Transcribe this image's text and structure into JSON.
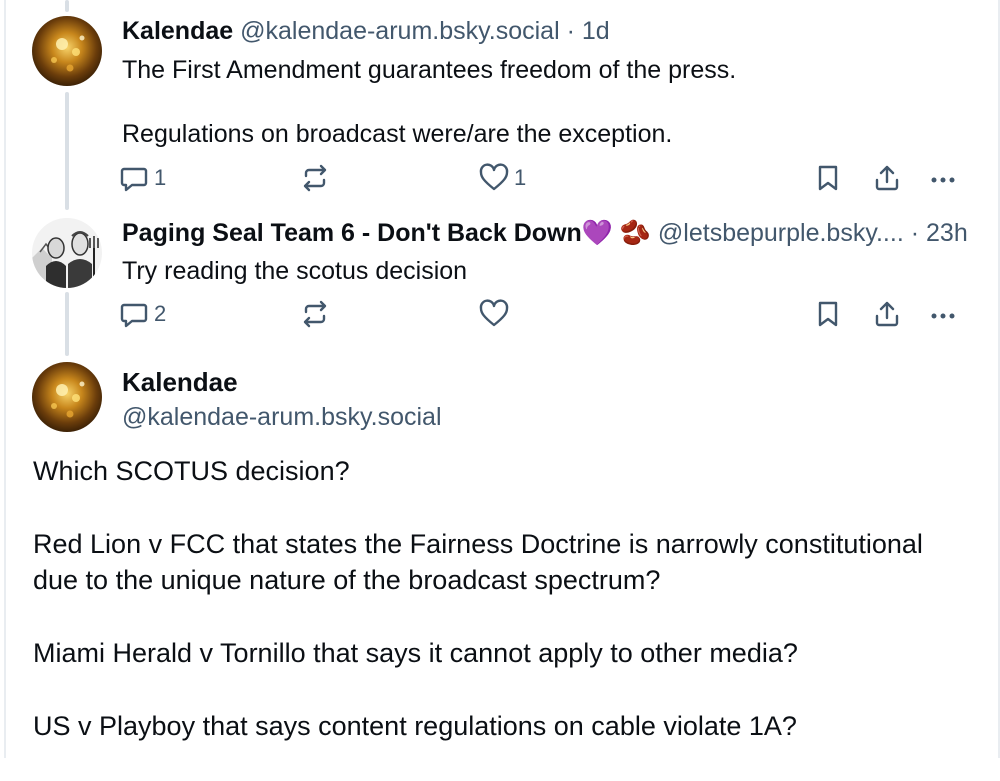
{
  "posts": [
    {
      "author": "Kalendae",
      "handle": "@kalendae-arum.bsky.social",
      "time": "1d",
      "text": "The First Amendment guarantees freedom of the press.\n\nRegulations on broadcast were/are the exception.",
      "replies": "1",
      "likes": "1",
      "avatar_icon": "amber-sparkle-avatar"
    },
    {
      "author": "Paging Seal Team 6 - Don't Back Down",
      "author_emoji": "💜 🫘",
      "handle": "@letsbepurple.bsky....",
      "time": "23h",
      "text": "Try reading the scotus decision",
      "replies": "2",
      "likes": "",
      "avatar_icon": "american-gothic-avatar"
    }
  ],
  "main_post": {
    "author": "Kalendae",
    "handle": "@kalendae-arum.bsky.social",
    "paragraphs": [
      "Which SCOTUS decision?",
      "Red Lion v FCC that states the Fairness Doctrine is narrowly constitutional due to the unique nature of the broadcast spectrum?",
      "Miami Herald v Tornillo that says it cannot apply to other media?",
      "US v Playboy that says content regulations on cable violate 1A?"
    ]
  },
  "separator": "·",
  "colors": {
    "text": "#0b0f14",
    "muted": "#42576c",
    "thread_line": "#d9dfe5",
    "emoji_heart": "#a855f7"
  }
}
